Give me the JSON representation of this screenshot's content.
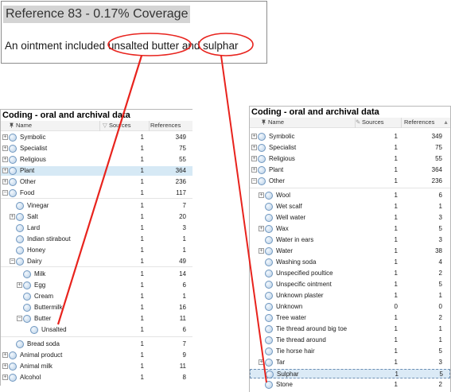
{
  "reference": {
    "title": "Reference 83 - 0.17% Coverage",
    "text": "An ointment included unsalted butter and sulphar"
  },
  "left_panel": {
    "title": "Coding - oral and archival data",
    "columns": {
      "name": "Name",
      "sources": "Sources",
      "references": "References"
    },
    "rows": [
      {
        "name": "Symbolic",
        "sources": "1",
        "references": "349",
        "level": 0,
        "expander": "+"
      },
      {
        "name": "Specialist",
        "sources": "1",
        "references": "75",
        "level": 0,
        "expander": "+"
      },
      {
        "name": "Religious",
        "sources": "1",
        "references": "55",
        "level": 0,
        "expander": "+"
      },
      {
        "name": "Plant",
        "sources": "1",
        "references": "364",
        "level": 0,
        "expander": "+",
        "selected": true
      },
      {
        "name": "Other",
        "sources": "1",
        "references": "236",
        "level": 0,
        "expander": "+"
      },
      {
        "name": "Food",
        "sources": "1",
        "references": "117",
        "level": 0,
        "expander": "-"
      },
      {
        "name": "Vinegar",
        "sources": "1",
        "references": "7",
        "level": 1,
        "expander": ""
      },
      {
        "name": "Salt",
        "sources": "1",
        "references": "20",
        "level": 1,
        "expander": "+"
      },
      {
        "name": "Lard",
        "sources": "1",
        "references": "3",
        "level": 1,
        "expander": ""
      },
      {
        "name": "Indian stirabout",
        "sources": "1",
        "references": "1",
        "level": 1,
        "expander": ""
      },
      {
        "name": "Honey",
        "sources": "1",
        "references": "1",
        "level": 1,
        "expander": ""
      },
      {
        "name": "Dairy",
        "sources": "1",
        "references": "49",
        "level": 1,
        "expander": "-"
      },
      {
        "name": "Milk",
        "sources": "1",
        "references": "14",
        "level": 2,
        "expander": ""
      },
      {
        "name": "Egg",
        "sources": "1",
        "references": "6",
        "level": 2,
        "expander": "+"
      },
      {
        "name": "Cream",
        "sources": "1",
        "references": "1",
        "level": 2,
        "expander": ""
      },
      {
        "name": "Buttermilk",
        "sources": "1",
        "references": "16",
        "level": 2,
        "expander": ""
      },
      {
        "name": "Butter",
        "sources": "1",
        "references": "11",
        "level": 2,
        "expander": "-"
      },
      {
        "name": "Unsalted",
        "sources": "1",
        "references": "6",
        "level": 3,
        "expander": ""
      },
      {
        "name": "Bread soda",
        "sources": "1",
        "references": "7",
        "level": 1,
        "expander": ""
      },
      {
        "name": "Animal product",
        "sources": "1",
        "references": "9",
        "level": 0,
        "expander": "+"
      },
      {
        "name": "Animal milk",
        "sources": "1",
        "references": "11",
        "level": 0,
        "expander": "+"
      },
      {
        "name": "Alcohol",
        "sources": "1",
        "references": "8",
        "level": 0,
        "expander": "+"
      }
    ]
  },
  "right_panel": {
    "title": "Coding - oral and archival data",
    "columns": {
      "name": "Name",
      "sources": "Sources",
      "references": "References"
    },
    "rows": [
      {
        "name": "Symbolic",
        "sources": "1",
        "references": "349",
        "level": 0,
        "expander": "+"
      },
      {
        "name": "Specialist",
        "sources": "1",
        "references": "75",
        "level": 0,
        "expander": "+"
      },
      {
        "name": "Religious",
        "sources": "1",
        "references": "55",
        "level": 0,
        "expander": "+"
      },
      {
        "name": "Plant",
        "sources": "1",
        "references": "364",
        "level": 0,
        "expander": "+"
      },
      {
        "name": "Other",
        "sources": "1",
        "references": "236",
        "level": 0,
        "expander": "-"
      },
      {
        "name": "Wool",
        "sources": "1",
        "references": "6",
        "level": 1,
        "expander": "+"
      },
      {
        "name": "Wet scalf",
        "sources": "1",
        "references": "1",
        "level": 1,
        "expander": ""
      },
      {
        "name": "Well water",
        "sources": "1",
        "references": "3",
        "level": 1,
        "expander": ""
      },
      {
        "name": "Wax",
        "sources": "1",
        "references": "5",
        "level": 1,
        "expander": "+"
      },
      {
        "name": "Water in ears",
        "sources": "1",
        "references": "3",
        "level": 1,
        "expander": ""
      },
      {
        "name": "Water",
        "sources": "1",
        "references": "38",
        "level": 1,
        "expander": "+"
      },
      {
        "name": "Washing soda",
        "sources": "1",
        "references": "4",
        "level": 1,
        "expander": ""
      },
      {
        "name": "Unspecified poultice",
        "sources": "1",
        "references": "2",
        "level": 1,
        "expander": ""
      },
      {
        "name": "Unspecific ointment",
        "sources": "1",
        "references": "5",
        "level": 1,
        "expander": ""
      },
      {
        "name": "Unknown plaster",
        "sources": "1",
        "references": "1",
        "level": 1,
        "expander": ""
      },
      {
        "name": "Unknown",
        "sources": "0",
        "references": "0",
        "level": 1,
        "expander": ""
      },
      {
        "name": "Tree water",
        "sources": "1",
        "references": "2",
        "level": 1,
        "expander": ""
      },
      {
        "name": "Tie thread around big toe",
        "sources": "1",
        "references": "1",
        "level": 1,
        "expander": ""
      },
      {
        "name": "Tie thread around",
        "sources": "1",
        "references": "1",
        "level": 1,
        "expander": ""
      },
      {
        "name": "Tie horse hair",
        "sources": "1",
        "references": "5",
        "level": 1,
        "expander": ""
      },
      {
        "name": "Tar",
        "sources": "1",
        "references": "3",
        "level": 1,
        "expander": "+"
      },
      {
        "name": "Sulphar",
        "sources": "1",
        "references": "5",
        "level": 1,
        "expander": "",
        "highlighted": true
      },
      {
        "name": "Stone",
        "sources": "1",
        "references": "2",
        "level": 1,
        "expander": ""
      }
    ]
  },
  "colors": {
    "annotation": "#e8231d",
    "selection": "#d6e9f5",
    "node": "#b7cfe6"
  },
  "icons": {
    "pin": "pin-icon",
    "node": "node-circle-icon",
    "expand": "expand-toggle-icon"
  }
}
